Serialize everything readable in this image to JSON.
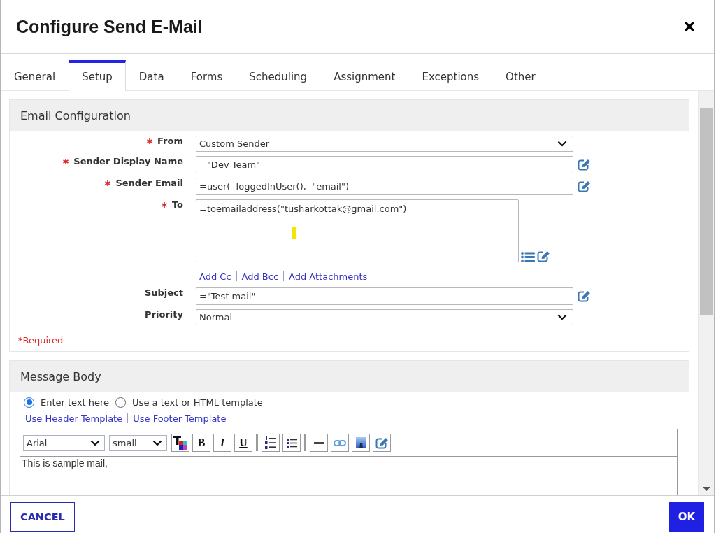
{
  "dialog": {
    "title": "Configure Send E-Mail"
  },
  "tabs": [
    {
      "label": "General",
      "selected": false
    },
    {
      "label": "Setup",
      "selected": true
    },
    {
      "label": "Data",
      "selected": false
    },
    {
      "label": "Forms",
      "selected": false
    },
    {
      "label": "Scheduling",
      "selected": false
    },
    {
      "label": "Assignment",
      "selected": false
    },
    {
      "label": "Exceptions",
      "selected": false
    },
    {
      "label": "Other",
      "selected": false
    }
  ],
  "email_configuration": {
    "title": "Email Configuration",
    "fields": [
      {
        "kind": "select",
        "label": "From",
        "required": true,
        "value": "Custom Sender"
      },
      {
        "kind": "text",
        "label": "Sender Display Name",
        "required": true,
        "value": "=\"Dev Team\""
      },
      {
        "kind": "text",
        "label": "Sender Email",
        "required": true,
        "value": "=user(  loggedInUser(),  \"email\")"
      },
      {
        "kind": "textarea",
        "label": "To",
        "required": true,
        "value": "=toemailaddress(\"tusharkottak@gmail.com\")"
      },
      {
        "kind": "links",
        "links": [
          "Add Cc",
          "Add Bcc",
          "Add Attachments"
        ]
      },
      {
        "kind": "text",
        "label": "Subject",
        "required": false,
        "value": "=\"Test mail\""
      },
      {
        "kind": "select",
        "label": "Priority",
        "required": false,
        "value": "Normal"
      }
    ],
    "required_note": "*Required"
  },
  "message_body": {
    "title": "Message Body",
    "options": [
      {
        "label": "Enter text here",
        "selected": true
      },
      {
        "label": "Use a text or HTML template",
        "selected": false
      }
    ],
    "template_links": [
      "Use Header Template",
      "Use Footer Template"
    ],
    "editor": {
      "font": "Arial",
      "size": "small",
      "tools": [
        {
          "kind": "text-color"
        },
        {
          "kind": "bold",
          "label": "B"
        },
        {
          "kind": "italic",
          "label": "I"
        },
        {
          "kind": "underline",
          "label": "U"
        },
        {
          "kind": "separator"
        },
        {
          "kind": "ordered-list"
        },
        {
          "kind": "bullet-list"
        },
        {
          "kind": "separator"
        },
        {
          "kind": "rule"
        },
        {
          "kind": "link"
        },
        {
          "kind": "image"
        },
        {
          "kind": "edit"
        }
      ],
      "text": "This is sample mail,"
    }
  },
  "buttons": [
    {
      "kind": "cancel",
      "label": "CANCEL"
    },
    {
      "kind": "ok",
      "label": "OK"
    }
  ]
}
